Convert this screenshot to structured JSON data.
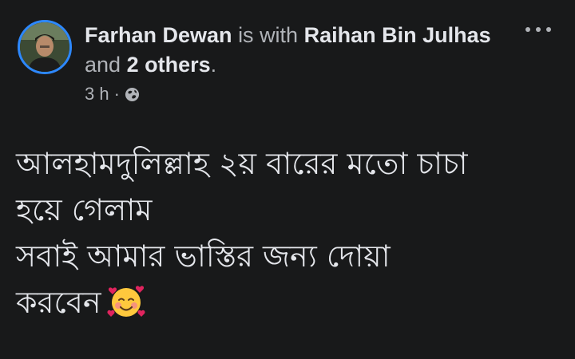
{
  "post": {
    "author": "Farhan Dewan",
    "with_text": "is with",
    "tagged_user": "Raihan Bin Julhas",
    "and_text": "and",
    "others": "2 others",
    "period": ".",
    "time": "3 h",
    "separator": "·",
    "privacy_icon": "globe-icon",
    "more_icon": "ellipsis-icon",
    "message_lines": [
      "আলহামদুলিল্লাহ ২য় বারের মতো চাচা",
      "হয়ে গেলাম",
      "সবাই আমার ভাস্তির জন্য দোয়া",
      "করবেন"
    ],
    "emoji": "smiling-face-with-hearts"
  },
  "colors": {
    "background": "#18191a",
    "primary_text": "#e4e6eb",
    "secondary_text": "#b0b3b8",
    "avatar_ring": "#2d88ff"
  }
}
